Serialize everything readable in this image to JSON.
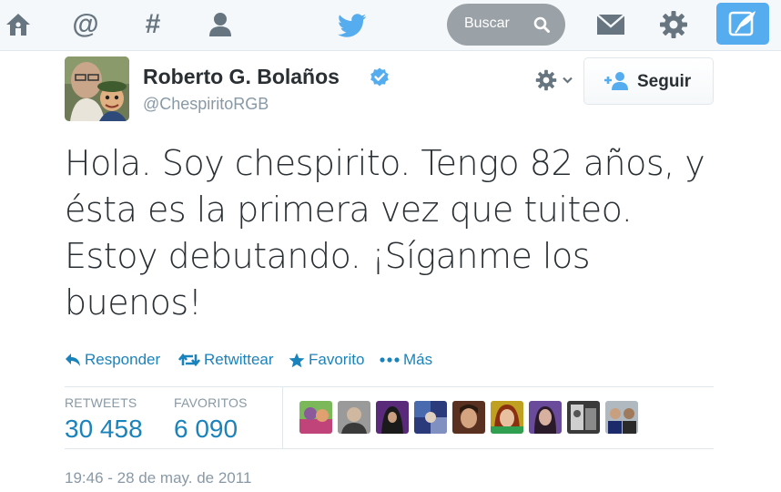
{
  "colors": {
    "accent": "#1b83bb",
    "nav_icon": "#66757f",
    "twitter_blue": "#55acee",
    "verified_blue": "#55acee",
    "muted_text": "#8899a6",
    "body_text": "#292f33"
  },
  "nav": {
    "items": [
      {
        "name": "home",
        "icon": "home-icon"
      },
      {
        "name": "connect",
        "icon": "at-sign-icon",
        "glyph": "@"
      },
      {
        "name": "discover",
        "icon": "hashtag-icon",
        "glyph": "#"
      },
      {
        "name": "me",
        "icon": "person-icon"
      }
    ],
    "logo_icon": "twitter-bird-icon",
    "search_placeholder": "Buscar",
    "search_icon": "magnifier-icon",
    "messages_icon": "envelope-icon",
    "settings_icon": "gear-icon",
    "compose_icon": "compose-tweet-icon"
  },
  "tweet": {
    "author_name": "Roberto G. Bolaños",
    "verified_icon": "verified-badge-icon",
    "handle": "@ChespiritoRGB",
    "follow_label": "Seguir",
    "follow_icon": "add-person-icon",
    "more_options_icon": "gear-dropdown-icon",
    "text": "Hola. Soy chespirito. Tengo 82 años, y ésta es la primera vez que tuiteo. Estoy debutando. ¡Síganme los buenos!",
    "actions": [
      {
        "label": "Responder",
        "icon": "reply-icon"
      },
      {
        "label": "Retwittear",
        "icon": "retweet-icon"
      },
      {
        "label": "Favorito",
        "icon": "star-icon"
      },
      {
        "label": "Más",
        "icon": "more-dots-icon"
      }
    ],
    "stats": {
      "retweets_label": "RETWEETS",
      "retweets_value": "30 458",
      "favorites_label": "FAVORITOS",
      "favorites_value": "6 090"
    },
    "favoriters_count_shown": 9,
    "timestamp": "19:46 - 28 de may. de 2011"
  }
}
